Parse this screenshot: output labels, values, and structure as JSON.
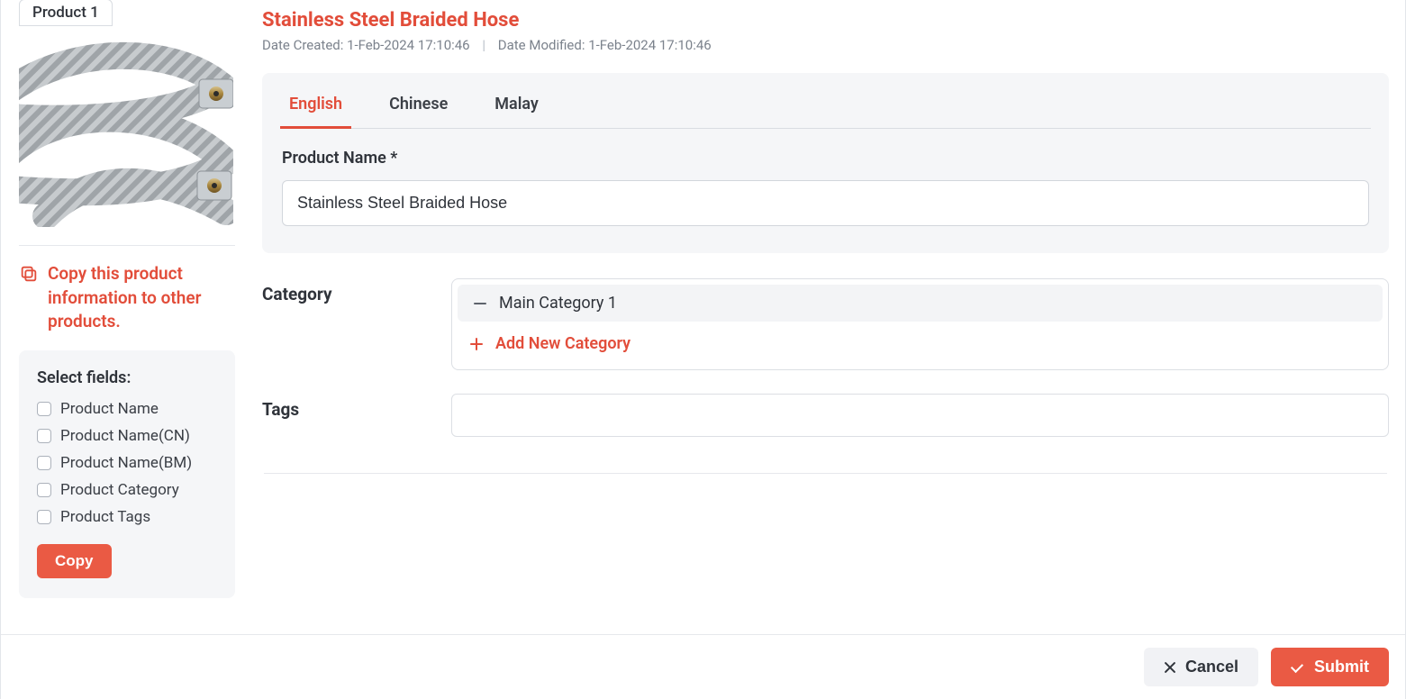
{
  "sidebar": {
    "product_tab_label": "Product 1",
    "copy_heading": "Copy this product information to other products.",
    "select_fields_title": "Select fields:",
    "fields": [
      {
        "label": "Product Name"
      },
      {
        "label": "Product Name(CN)"
      },
      {
        "label": "Product Name(BM)"
      },
      {
        "label": "Product Category"
      },
      {
        "label": "Product Tags"
      }
    ],
    "copy_button_label": "Copy"
  },
  "main": {
    "title": "Stainless Steel Braided Hose",
    "date_created_label": "Date Created:",
    "date_created_value": "1-Feb-2024 17:10:46",
    "date_modified_label": "Date Modified:",
    "date_modified_value": "1-Feb-2024 17:10:46",
    "tabs": {
      "english": "English",
      "chinese": "Chinese",
      "malay": "Malay"
    },
    "product_name_label": "Product Name *",
    "product_name_value": "Stainless Steel Braided Hose",
    "category_label": "Category",
    "category_item": "Main Category 1",
    "add_category_label": "Add New Category",
    "tags_label": "Tags"
  },
  "footer": {
    "cancel_label": "Cancel",
    "submit_label": "Submit"
  }
}
